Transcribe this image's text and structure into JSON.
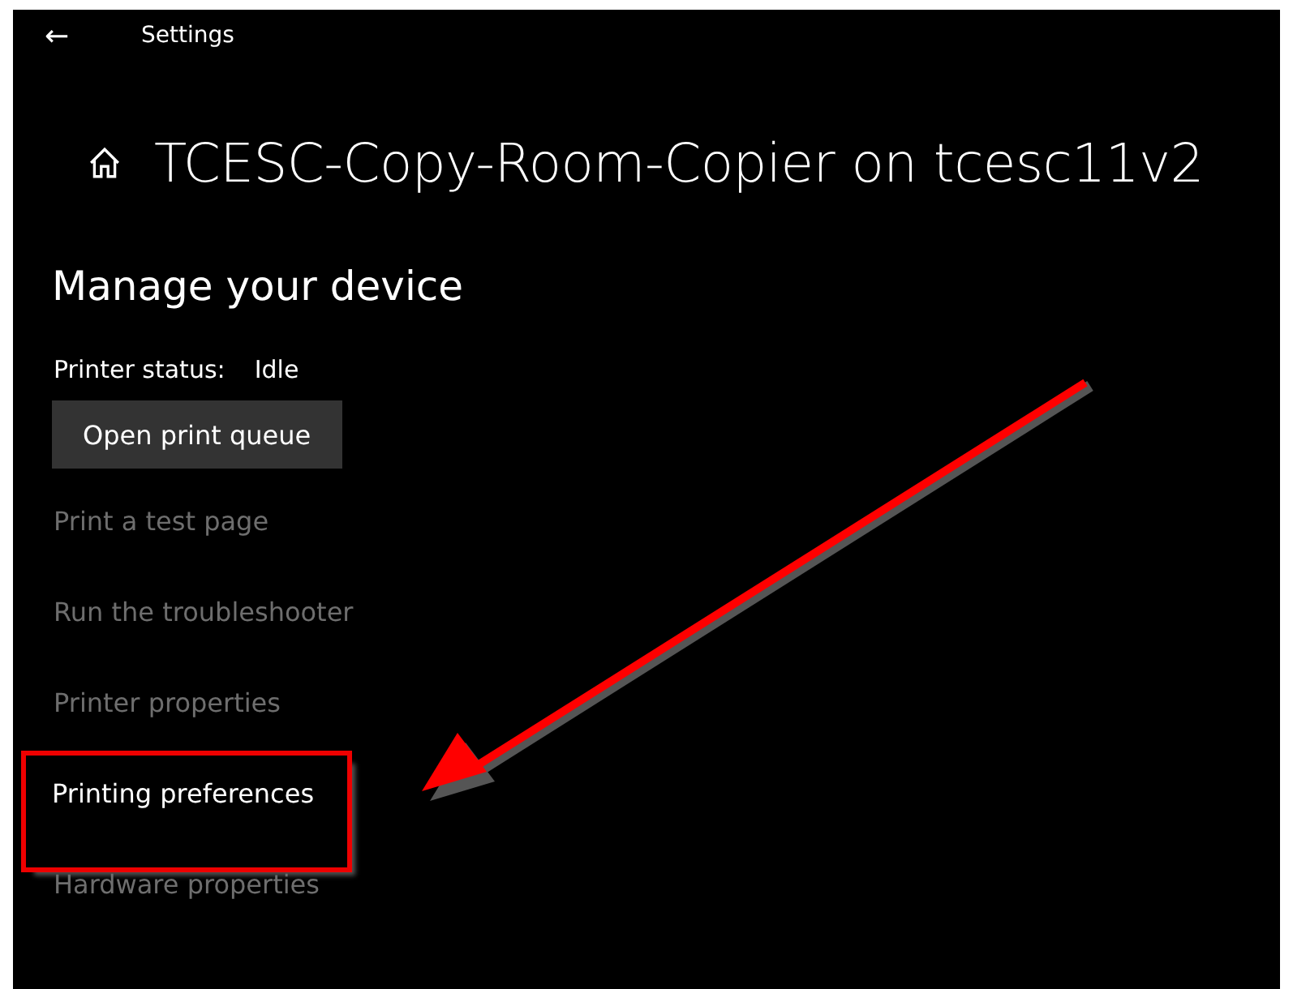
{
  "window": {
    "title": "Settings",
    "back": "←"
  },
  "page": {
    "title": "TCESC-Copy-Room-Copier on tcesc11v2"
  },
  "section": {
    "heading": "Manage your device",
    "status_label": "Printer status:",
    "status_value": "Idle",
    "button": "Open print queue"
  },
  "links": [
    {
      "label": "Print a test page",
      "disabled": true,
      "highlighted": false
    },
    {
      "label": "Run the troubleshooter",
      "disabled": true,
      "highlighted": false
    },
    {
      "label": "Printer properties",
      "disabled": true,
      "highlighted": false
    },
    {
      "label": "Printing preferences",
      "disabled": false,
      "highlighted": true
    },
    {
      "label": "Hardware properties",
      "disabled": true,
      "highlighted": false
    }
  ]
}
